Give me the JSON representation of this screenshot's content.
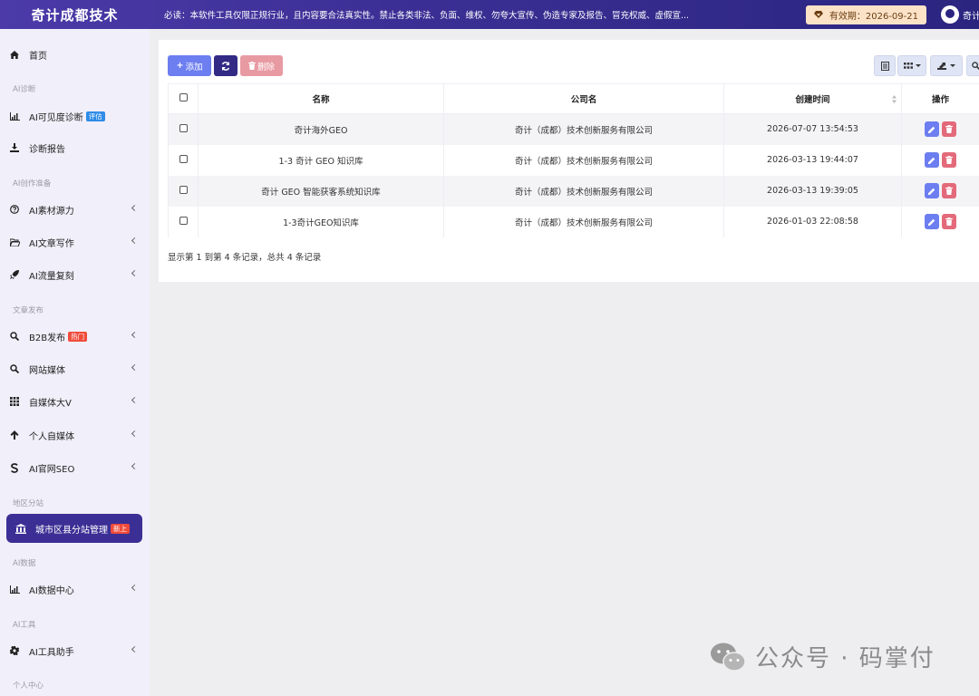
{
  "header": {
    "brand": "奇计成都技术",
    "notice": "必读：本软件工具仅限正规行业，且内容要合法真实性。禁止各类非法、负面、维权、勿夸大宣传、伪造专家及报告、冒充权威、虚假宣...",
    "valid_until": "有效期：2026-09-21",
    "user_name": "奇计"
  },
  "sidebar": {
    "home": "首页",
    "sec_ai_diag": "AI诊断",
    "visibility": "AI可见度诊断",
    "visibility_badge": "评估",
    "report": "诊断报告",
    "sec_ai_create": "AI创作准备",
    "material": "AI素材源力",
    "article": "AI文章写作",
    "traffic": "AI流量复刻",
    "sec_publish": "文章发布",
    "b2b": "B2B发布",
    "b2b_badge": "热门",
    "site_media": "网站媒体",
    "self_media_v": "自媒体大V",
    "personal_media": "个人自媒体",
    "official_seo": "AI官网SEO",
    "sec_region": "地区分站",
    "city_station": "城市区县分站管理",
    "city_badge": "新上",
    "sec_ai_data": "AI数据",
    "data_center": "AI数据中心",
    "sec_ai_tools": "AI工具",
    "tool_helper": "AI工具助手",
    "sec_personal": "个人中心"
  },
  "toolbar": {
    "add": "添加",
    "delete": "删除"
  },
  "table": {
    "columns": [
      "名称",
      "公司名",
      "创建时间",
      "操作"
    ],
    "rows": [
      {
        "name": "奇计海外GEO",
        "company": "奇计（成都）技术创新服务有限公司",
        "created": "2026-07-07 13:54:53"
      },
      {
        "name": "1-3 奇计 GEO 知识库",
        "company": "奇计（成都）技术创新服务有限公司",
        "created": "2026-03-13 19:44:07"
      },
      {
        "name": "奇计 GEO 智能获客系统知识库",
        "company": "奇计（成都）技术创新服务有限公司",
        "created": "2026-03-13 19:39:05"
      },
      {
        "name": "1-3奇计GEO知识库",
        "company": "奇计（成都）技术创新服务有限公司",
        "created": "2026-01-03 22:08:58"
      }
    ],
    "summary": "显示第 1 到第 4 条记录，总共 4 条记录"
  },
  "watermark": {
    "text": "公众号 · 码掌付"
  },
  "colors": {
    "primary": "#3b2f95",
    "add": "#6c7ef0",
    "delete": "#e89aa3",
    "badge_blue": "#2f8be6",
    "badge_red": "#f04b3b"
  }
}
